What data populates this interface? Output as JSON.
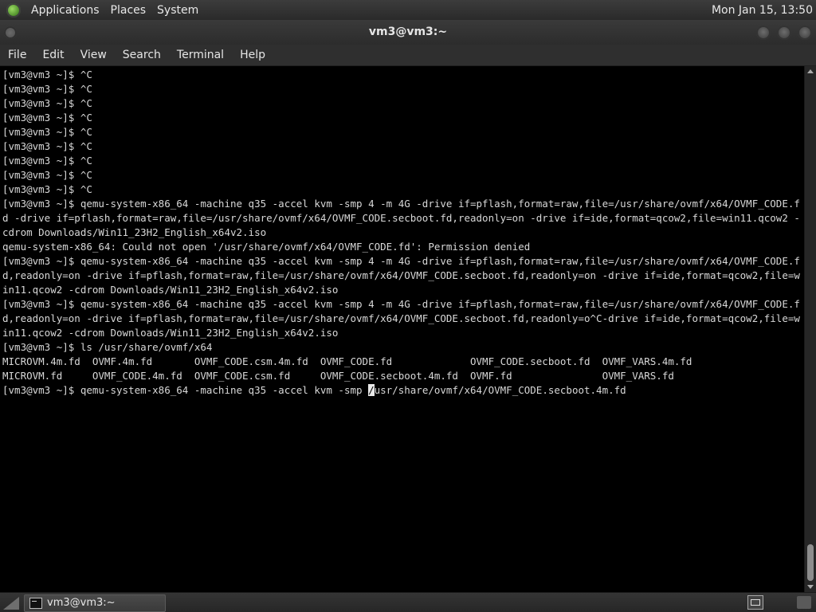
{
  "top_panel": {
    "menus": [
      "Applications",
      "Places",
      "System"
    ],
    "clock": "Mon Jan 15, 13:50"
  },
  "window": {
    "title": "vm3@vm3:~",
    "menubar": [
      "File",
      "Edit",
      "View",
      "Search",
      "Terminal",
      "Help"
    ]
  },
  "terminal": {
    "lines": [
      "[vm3@vm3 ~]$ ^C",
      "[vm3@vm3 ~]$ ^C",
      "[vm3@vm3 ~]$ ^C",
      "[vm3@vm3 ~]$ ^C",
      "[vm3@vm3 ~]$ ^C",
      "[vm3@vm3 ~]$ ^C",
      "[vm3@vm3 ~]$ ^C",
      "[vm3@vm3 ~]$ ^C",
      "[vm3@vm3 ~]$ ^C",
      "[vm3@vm3 ~]$ qemu-system-x86_64 -machine q35 -accel kvm -smp 4 -m 4G -drive if=pflash,format=raw,file=/usr/share/ovmf/x64/OVMF_CODE.fd -drive if=pflash,format=raw,file=/usr/share/ovmf/x64/OVMF_CODE.secboot.fd,readonly=on -drive if=ide,format=qcow2,file=win11.qcow2 -cdrom Downloads/Win11_23H2_English_x64v2.iso",
      "qemu-system-x86_64: Could not open '/usr/share/ovmf/x64/OVMF_CODE.fd': Permission denied",
      "[vm3@vm3 ~]$ qemu-system-x86_64 -machine q35 -accel kvm -smp 4 -m 4G -drive if=pflash,format=raw,file=/usr/share/ovmf/x64/OVMF_CODE.fd,readonly=on -drive if=pflash,format=raw,file=/usr/share/ovmf/x64/OVMF_CODE.secboot.fd,readonly=on -drive if=ide,format=qcow2,file=win11.qcow2 -cdrom Downloads/Win11_23H2_English_x64v2.iso",
      "[vm3@vm3 ~]$ qemu-system-x86_64 -machine q35 -accel kvm -smp 4 -m 4G -drive if=pflash,format=raw,file=/usr/share/ovmf/x64/OVMF_CODE.fd,readonly=on -drive if=pflash,format=raw,file=/usr/share/ovmf/x64/OVMF_CODE.secboot.fd,readonly=o^C-drive if=ide,format=qcow2,file=win11.qcow2 -cdrom Downloads/Win11_23H2_English_x64v2.iso",
      "[vm3@vm3 ~]$ ls /usr/share/ovmf/x64",
      "MICROVM.4m.fd  OVMF.4m.fd       OVMF_CODE.csm.4m.fd  OVMF_CODE.fd             OVMF_CODE.secboot.fd  OVMF_VARS.4m.fd",
      "MICROVM.fd     OVMF_CODE.4m.fd  OVMF_CODE.csm.fd     OVMF_CODE.secboot.4m.fd  OVMF.fd               OVMF_VARS.fd"
    ],
    "prompt_line": {
      "before_cursor": "[vm3@vm3 ~]$ qemu-system-x86_64 -machine q35 -accel kvm -smp ",
      "cursor_char": "/",
      "after_cursor": "usr/share/ovmf/x64/OVMF_CODE.secboot.4m.fd"
    }
  },
  "bottom_panel": {
    "task_label": "vm3@vm3:~"
  },
  "icons": {
    "apps_logo": "gnome-foot-icon",
    "show_desktop": "show-desktop-icon",
    "terminal_task": "terminal-icon",
    "workspace": "workspace-switcher-icon"
  }
}
